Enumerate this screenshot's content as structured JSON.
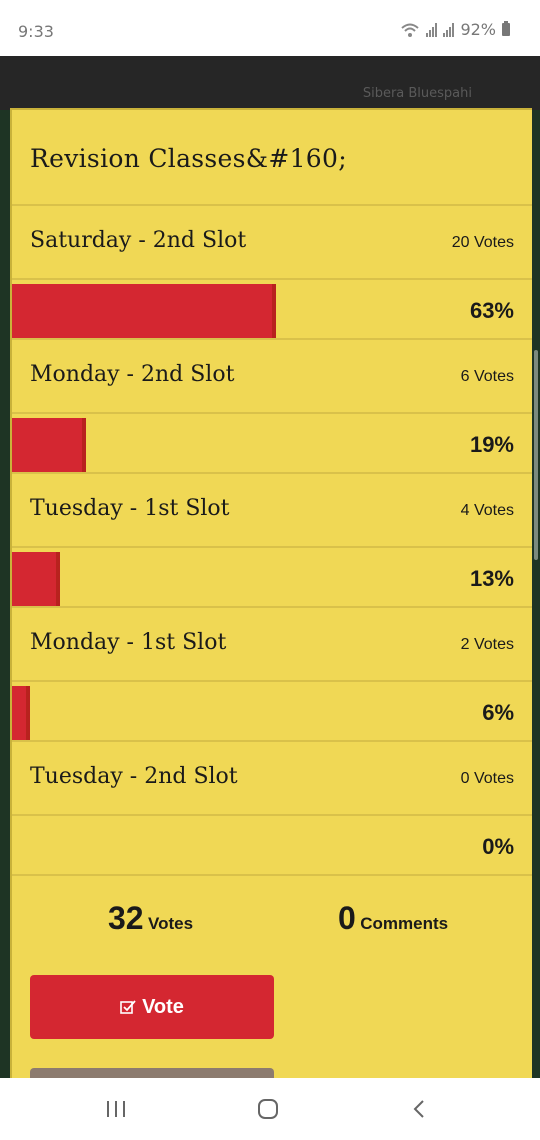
{
  "status_bar": {
    "time": "9:33",
    "battery": "92%"
  },
  "app_header": {
    "ghost_text": "Sibera Bluespahi"
  },
  "poll": {
    "title": "Revision Classes&#160;",
    "options": [
      {
        "label": "Saturday - 2nd Slot",
        "votes": "20 Votes",
        "percent": "63%",
        "fraction": 0.63
      },
      {
        "label": "Monday - 2nd Slot",
        "votes": "6 Votes",
        "percent": "19%",
        "fraction": 0.19
      },
      {
        "label": "Tuesday - 1st Slot",
        "votes": "4 Votes",
        "percent": "13%",
        "fraction": 0.13
      },
      {
        "label": "Monday - 1st Slot",
        "votes": "2 Votes",
        "percent": "6%",
        "fraction": 0.06
      },
      {
        "label": "Tuesday - 2nd Slot",
        "votes": "0 Votes",
        "percent": "0%",
        "fraction": 0.0
      }
    ],
    "totals": {
      "votes_count": "32",
      "votes_label": "Votes",
      "comments_count": "0",
      "comments_label": "Comments"
    },
    "vote_button": {
      "label": "Vote",
      "icon": "edit-check-icon"
    }
  },
  "colors": {
    "card_bg": "#f0d855",
    "bar_red": "#d42731",
    "dark_strip": "#1e3424",
    "header_bg": "#262626"
  },
  "nav_bar": {
    "icons": [
      "recent-apps-icon",
      "home-icon",
      "back-icon"
    ]
  }
}
